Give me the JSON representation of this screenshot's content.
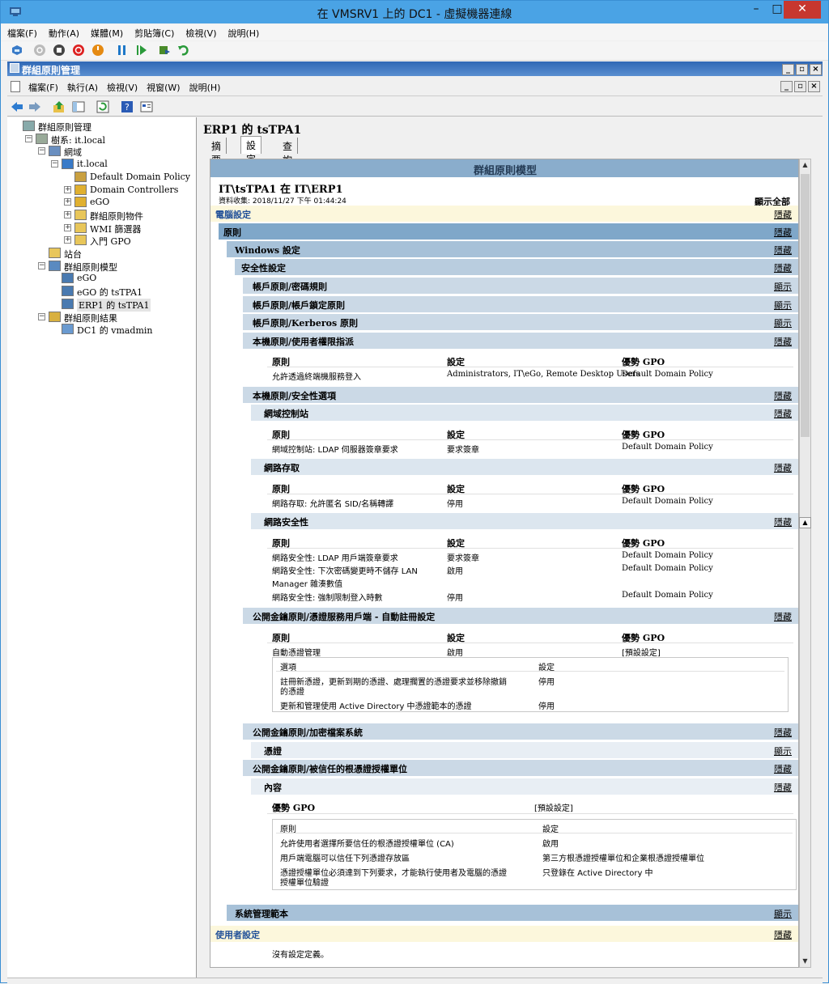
{
  "vm": {
    "title": "在 VMSRV1 上的 DC1 - 虛擬機器連線",
    "min_glyph": "–",
    "max_glyph": "□",
    "close_glyph": "✕",
    "menu": [
      "檔案(F)",
      "動作(A)",
      "媒體(M)",
      "剪貼簿(C)",
      "檢視(V)",
      "說明(H)"
    ]
  },
  "mmc": {
    "title": "群組原則管理",
    "menu": [
      "檔案(F)",
      "執行(A)",
      "檢視(V)",
      "視窗(W)",
      "說明(H)"
    ]
  },
  "tree": [
    {
      "label": "群組原則管理",
      "level": 0,
      "exp": ""
    },
    {
      "label": "樹系: it.local",
      "level": 1,
      "exp": "−"
    },
    {
      "label": "網域",
      "level": 2,
      "exp": "−"
    },
    {
      "label": "it.local",
      "level": 3,
      "exp": "−"
    },
    {
      "label": "Default Domain Policy",
      "level": 4,
      "exp": ""
    },
    {
      "label": "Domain Controllers",
      "level": 4,
      "exp": "+"
    },
    {
      "label": "eGO",
      "level": 4,
      "exp": "+"
    },
    {
      "label": "群組原則物件",
      "level": 4,
      "exp": "+"
    },
    {
      "label": "WMI 篩選器",
      "level": 4,
      "exp": "+"
    },
    {
      "label": "入門 GPO",
      "level": 4,
      "exp": "+"
    },
    {
      "label": "站台",
      "level": 2,
      "exp": ""
    },
    {
      "label": "群組原則模型",
      "level": 2,
      "exp": "−"
    },
    {
      "label": "eGO",
      "level": 3,
      "exp": ""
    },
    {
      "label": "eGO 的 tsTPA1",
      "level": 3,
      "exp": ""
    },
    {
      "label": "ERP1 的 tsTPA1",
      "level": 3,
      "exp": "",
      "selected": true
    },
    {
      "label": "群組原則結果",
      "level": 2,
      "exp": "−"
    },
    {
      "label": "DC1 的 vmadmin",
      "level": 3,
      "exp": ""
    }
  ],
  "right": {
    "title": "ERP1 的 tsTPA1",
    "tabs": [
      "摘要",
      "設定",
      "查詢"
    ],
    "active_tab": 1
  },
  "report": {
    "header": "群組原則模型",
    "subject": "IT\\tsTPA1 在 IT\\ERP1",
    "collected": "資料收集: 2018/11/27 下午 01:44:24",
    "show_all": "顯示全部",
    "computer_settings": "電腦設定",
    "hide": "隱藏",
    "show": "顯示",
    "policies": "原則",
    "windows_settings": "Windows 設定",
    "security_settings": "安全性設定",
    "account_password": "帳戶原則/密碼規則",
    "account_lockout": "帳戶原則/帳戶鎖定原則",
    "account_kerberos": "帳戶原則/Kerberos 原則",
    "local_user_rights": "本機原則/使用者權限指派",
    "col_policy": "原則",
    "col_setting": "設定",
    "col_winning_gpo": "優勢 GPO",
    "ur_row": {
      "policy": "允許透過終端機服務登入",
      "setting": "Administrators, IT\\eGo, Remote Desktop Users",
      "gpo": "Default Domain Policy"
    },
    "local_security_options": "本機原則/安全性選項",
    "domain_controller": "網域控制站",
    "dc_row": {
      "policy": "網域控制站: LDAP 伺服器簽章要求",
      "setting": "要求簽章",
      "gpo": "Default Domain Policy"
    },
    "network_access": "網路存取",
    "na_row": {
      "policy": "網路存取: 允許匿名 SID/名稱轉譯",
      "setting": "停用",
      "gpo": "Default Domain Policy"
    },
    "network_security": "網路安全性",
    "ns_rows": [
      {
        "policy": "網路安全性: LDAP 用戶端簽章要求",
        "setting": "要求簽章",
        "gpo": "Default Domain Policy"
      },
      {
        "policy": "網路安全性: 下次密碼變更時不儲存 LAN",
        "policy2": "Manager 雜湊數值",
        "setting": "啟用",
        "gpo": "Default Domain Policy"
      },
      {
        "policy": "網路安全性: 強制限制登入時數",
        "setting": "停用",
        "gpo": "Default Domain Policy"
      }
    ],
    "pki_autoenroll": "公開金鑰原則/憑證服務用戶端 - 自動註冊設定",
    "ae_row": {
      "policy": "自動憑證管理",
      "setting": "啟用",
      "gpo": "[預設設定]"
    },
    "ae_opt_col": "選項",
    "ae_set_col": "設定",
    "ae_opts": [
      {
        "opt": "註冊新憑證，更新到期的憑證、處理擱置的憑證要求並移除撤銷",
        "opt2": "的憑證",
        "val": "停用"
      },
      {
        "opt": "更新和管理使用 Active Directory 中憑證範本的憑證",
        "opt2": "",
        "val": "停用"
      }
    ],
    "pki_efs": "公開金鑰原則/加密檔案系統",
    "certificates": "憑證",
    "pki_trusted_root": "公開金鑰原則/被信任的根憑證授權單位",
    "properties": "內容",
    "tr_gpo_label": "優勢 GPO",
    "tr_gpo_value": "[預設設定]",
    "tr_col_policy": "原則",
    "tr_col_setting": "設定",
    "tr_rows": [
      {
        "policy": "允許使用者選擇所要信任的根憑證授權單位 (CA)",
        "policy2": "",
        "val": "啟用"
      },
      {
        "policy": "用戶端電腦可以信任下列憑證存放區",
        "policy2": "",
        "val": "第三方根憑證授權單位和企業根憑證授權單位"
      },
      {
        "policy": "憑證授權單位必須達到下列要求，才能執行使用者及電腦的憑證",
        "policy2": "授權單位驗證",
        "val": "只登錄在 Active Directory 中"
      }
    ],
    "admin_templates": "系統管理範本",
    "user_settings": "使用者設定",
    "no_settings": "沒有設定定義。"
  }
}
